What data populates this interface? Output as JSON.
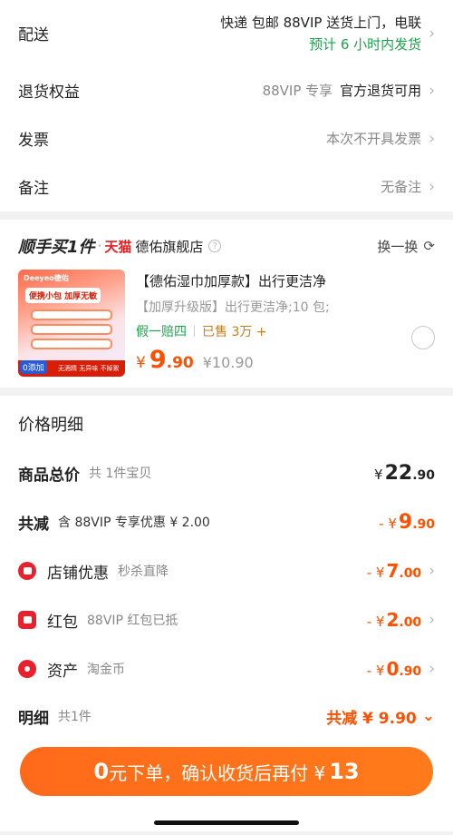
{
  "delivery": {
    "label": "配送",
    "line1": "快递 包邮 88VIP 送货上门，电联",
    "line2": "预计 6 小时内发货"
  },
  "returns": {
    "label": "退货权益",
    "tag": "88VIP 专享",
    "value": "官方退货可用"
  },
  "invoice": {
    "label": "发票",
    "value": "本次不开具发票"
  },
  "remark": {
    "label": "备注",
    "value": "无备注"
  },
  "addon": {
    "title": "顺手买1件",
    "dot": "·",
    "platform": "天猫",
    "shop": "德佑旗舰店",
    "help": "?",
    "swap": "换一换",
    "product": {
      "title": "【德佑湿巾加厚款】出行更洁净",
      "spec": "【加厚升级版】出行更洁净;10 包;",
      "tag1": "假一赔四",
      "tag2": "已售 3万 +",
      "currency": "¥",
      "price_int": "9",
      "price_dec": ".90",
      "orig_price": "¥10.90",
      "thumb": {
        "brand": "Deeyeo德佑",
        "banner": "便携小包 加厚无敏",
        "badge": "0添加",
        "foot": "无酒精 无异味 不掉絮"
      }
    }
  },
  "price_detail": {
    "title": "价格明细",
    "total": {
      "label": "商品总价",
      "sub": "共 1件宝贝",
      "pre": "¥",
      "int": "22",
      "dec": ".90"
    },
    "discount": {
      "label": "共减",
      "sub": "含 88VIP 专享优惠 ¥ 2.00",
      "pre": "- ¥",
      "int": "9",
      "dec": ".90"
    },
    "shop_coupon": {
      "label": "店铺优惠",
      "sub": "秒杀直降",
      "pre": "- ¥",
      "int": "7",
      "dec": ".00"
    },
    "red_packet": {
      "label": "红包",
      "sub": "88VIP 红包已抵",
      "pre": "- ¥",
      "int": "2",
      "dec": ".00"
    },
    "assets": {
      "label": "资产",
      "sub": "淘金币",
      "pre": "- ¥",
      "int": "0",
      "dec": ".90"
    },
    "summary": {
      "label": "明细",
      "sub": "共1件",
      "value": "共减 ¥ 9.90"
    }
  },
  "checkout": {
    "zero": "0",
    "text": "元下单，确认收货后再付 ¥",
    "amount": "13"
  },
  "colors": {
    "accent": "#ff5000",
    "green": "#1aa64a",
    "red": "#e8212c"
  }
}
